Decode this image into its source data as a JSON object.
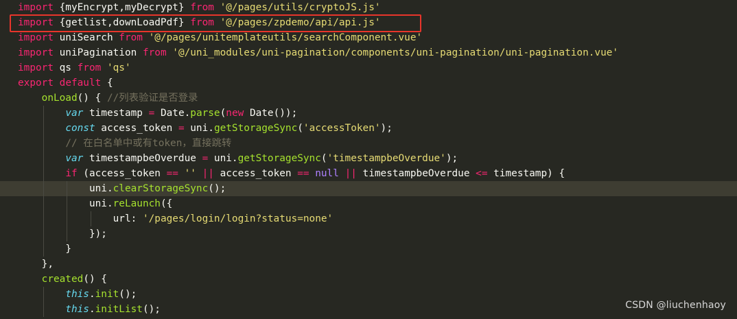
{
  "editor": {
    "lines": [
      {
        "indent": 0,
        "tokens": [
          {
            "t": "import",
            "c": "kw"
          },
          {
            "t": " {myEncrypt,myDecrypt} ",
            "c": "id"
          },
          {
            "t": "from",
            "c": "kw"
          },
          {
            "t": " ",
            "c": "id"
          },
          {
            "t": "'@/pages/utils/cryptoJS.js'",
            "c": "str"
          }
        ]
      },
      {
        "indent": 0,
        "highlighted": true,
        "tokens": [
          {
            "t": "import",
            "c": "kw"
          },
          {
            "t": " {getlist,downLoadPdf} ",
            "c": "id"
          },
          {
            "t": "from",
            "c": "kw"
          },
          {
            "t": " ",
            "c": "id"
          },
          {
            "t": "'@/pages/zpdemo/api/api.js'",
            "c": "str"
          }
        ]
      },
      {
        "indent": 0,
        "tokens": [
          {
            "t": "import",
            "c": "kw"
          },
          {
            "t": " uniSearch ",
            "c": "id"
          },
          {
            "t": "from",
            "c": "kw"
          },
          {
            "t": " ",
            "c": "id"
          },
          {
            "t": "'@/pages/unitemplateutils/searchComponent.vue'",
            "c": "str"
          }
        ]
      },
      {
        "indent": 0,
        "tokens": [
          {
            "t": "import",
            "c": "kw"
          },
          {
            "t": " uniPagination ",
            "c": "id"
          },
          {
            "t": "from",
            "c": "kw"
          },
          {
            "t": " ",
            "c": "id"
          },
          {
            "t": "'@/uni_modules/uni-pagination/components/uni-pagination/uni-pagination.vue'",
            "c": "str"
          }
        ]
      },
      {
        "indent": 0,
        "tokens": [
          {
            "t": "import",
            "c": "kw"
          },
          {
            "t": " qs ",
            "c": "id"
          },
          {
            "t": "from",
            "c": "kw"
          },
          {
            "t": " ",
            "c": "id"
          },
          {
            "t": "'qs'",
            "c": "str"
          }
        ]
      },
      {
        "indent": 0,
        "tokens": [
          {
            "t": "export",
            "c": "kw"
          },
          {
            "t": " ",
            "c": "id"
          },
          {
            "t": "default",
            "c": "kw"
          },
          {
            "t": " {",
            "c": "id"
          }
        ]
      },
      {
        "indent": 1,
        "tokens": [
          {
            "t": "onLoad",
            "c": "fn"
          },
          {
            "t": "() { ",
            "c": "id"
          },
          {
            "t": "//列表验证是否登录",
            "c": "cm"
          }
        ]
      },
      {
        "indent": 2,
        "tokens": [
          {
            "t": "var",
            "c": "it"
          },
          {
            "t": " timestamp ",
            "c": "id"
          },
          {
            "t": "=",
            "c": "kw"
          },
          {
            "t": " Date.",
            "c": "id"
          },
          {
            "t": "parse",
            "c": "fn"
          },
          {
            "t": "(",
            "c": "id"
          },
          {
            "t": "new",
            "c": "kw"
          },
          {
            "t": " Date());",
            "c": "id"
          }
        ]
      },
      {
        "indent": 2,
        "tokens": [
          {
            "t": "const",
            "c": "it"
          },
          {
            "t": " access_token ",
            "c": "id"
          },
          {
            "t": "=",
            "c": "kw"
          },
          {
            "t": " uni.",
            "c": "id"
          },
          {
            "t": "getStorageSync",
            "c": "fn"
          },
          {
            "t": "(",
            "c": "id"
          },
          {
            "t": "'accessToken'",
            "c": "str"
          },
          {
            "t": ");",
            "c": "id"
          }
        ]
      },
      {
        "indent": 2,
        "tokens": [
          {
            "t": "// 在白名单中或有token，直接跳转",
            "c": "cm"
          }
        ]
      },
      {
        "indent": 2,
        "tokens": [
          {
            "t": "var",
            "c": "it"
          },
          {
            "t": " timestampbeOverdue ",
            "c": "id"
          },
          {
            "t": "=",
            "c": "kw"
          },
          {
            "t": " uni.",
            "c": "id"
          },
          {
            "t": "getStorageSync",
            "c": "fn"
          },
          {
            "t": "(",
            "c": "id"
          },
          {
            "t": "'timestampbeOverdue'",
            "c": "str"
          },
          {
            "t": ");",
            "c": "id"
          }
        ]
      },
      {
        "indent": 2,
        "tokens": [
          {
            "t": "if",
            "c": "kw"
          },
          {
            "t": " (access_token ",
            "c": "id"
          },
          {
            "t": "==",
            "c": "kw"
          },
          {
            "t": " ",
            "c": "id"
          },
          {
            "t": "''",
            "c": "str"
          },
          {
            "t": " ",
            "c": "id"
          },
          {
            "t": "||",
            "c": "kw"
          },
          {
            "t": " access_token ",
            "c": "id"
          },
          {
            "t": "==",
            "c": "kw"
          },
          {
            "t": " ",
            "c": "id"
          },
          {
            "t": "null",
            "c": "nul"
          },
          {
            "t": " ",
            "c": "id"
          },
          {
            "t": "||",
            "c": "kw"
          },
          {
            "t": " timestampbeOverdue ",
            "c": "id"
          },
          {
            "t": "<=",
            "c": "kw"
          },
          {
            "t": " timestamp) {",
            "c": "id"
          }
        ]
      },
      {
        "indent": 3,
        "current": true,
        "tokens": [
          {
            "t": "uni.",
            "c": "id"
          },
          {
            "t": "clearStorageSync",
            "c": "fn"
          },
          {
            "t": "();",
            "c": "id"
          }
        ]
      },
      {
        "indent": 3,
        "tokens": [
          {
            "t": "uni.",
            "c": "id"
          },
          {
            "t": "reLaunch",
            "c": "fn"
          },
          {
            "t": "({",
            "c": "id"
          }
        ]
      },
      {
        "indent": 4,
        "tokens": [
          {
            "t": "url: ",
            "c": "id"
          },
          {
            "t": "'/pages/login/login?status=none'",
            "c": "str"
          }
        ]
      },
      {
        "indent": 3,
        "tokens": [
          {
            "t": "});",
            "c": "id"
          }
        ]
      },
      {
        "indent": 2,
        "tokens": [
          {
            "t": "}",
            "c": "id"
          }
        ]
      },
      {
        "indent": 1,
        "tokens": [
          {
            "t": "},",
            "c": "id"
          }
        ]
      },
      {
        "indent": 1,
        "tokens": [
          {
            "t": "created",
            "c": "fn"
          },
          {
            "t": "() {",
            "c": "id"
          }
        ]
      },
      {
        "indent": 2,
        "tokens": [
          {
            "t": "this",
            "c": "it"
          },
          {
            "t": ".",
            "c": "id"
          },
          {
            "t": "init",
            "c": "fn"
          },
          {
            "t": "();",
            "c": "id"
          }
        ]
      },
      {
        "indent": 2,
        "tokens": [
          {
            "t": "this",
            "c": "it"
          },
          {
            "t": ".",
            "c": "id"
          },
          {
            "t": "initList",
            "c": "fn"
          },
          {
            "t": "();",
            "c": "id"
          }
        ]
      }
    ]
  },
  "watermark": "CSDN @liuchenhaoy",
  "colors": {
    "background": "#272822",
    "keyword": "#f92672",
    "string": "#e6db74",
    "function": "#a6e22e",
    "storage": "#66d9ef",
    "constant": "#ae81ff",
    "comment": "#75715e",
    "text": "#f8f8f2",
    "highlight_box": "#e8352b"
  }
}
